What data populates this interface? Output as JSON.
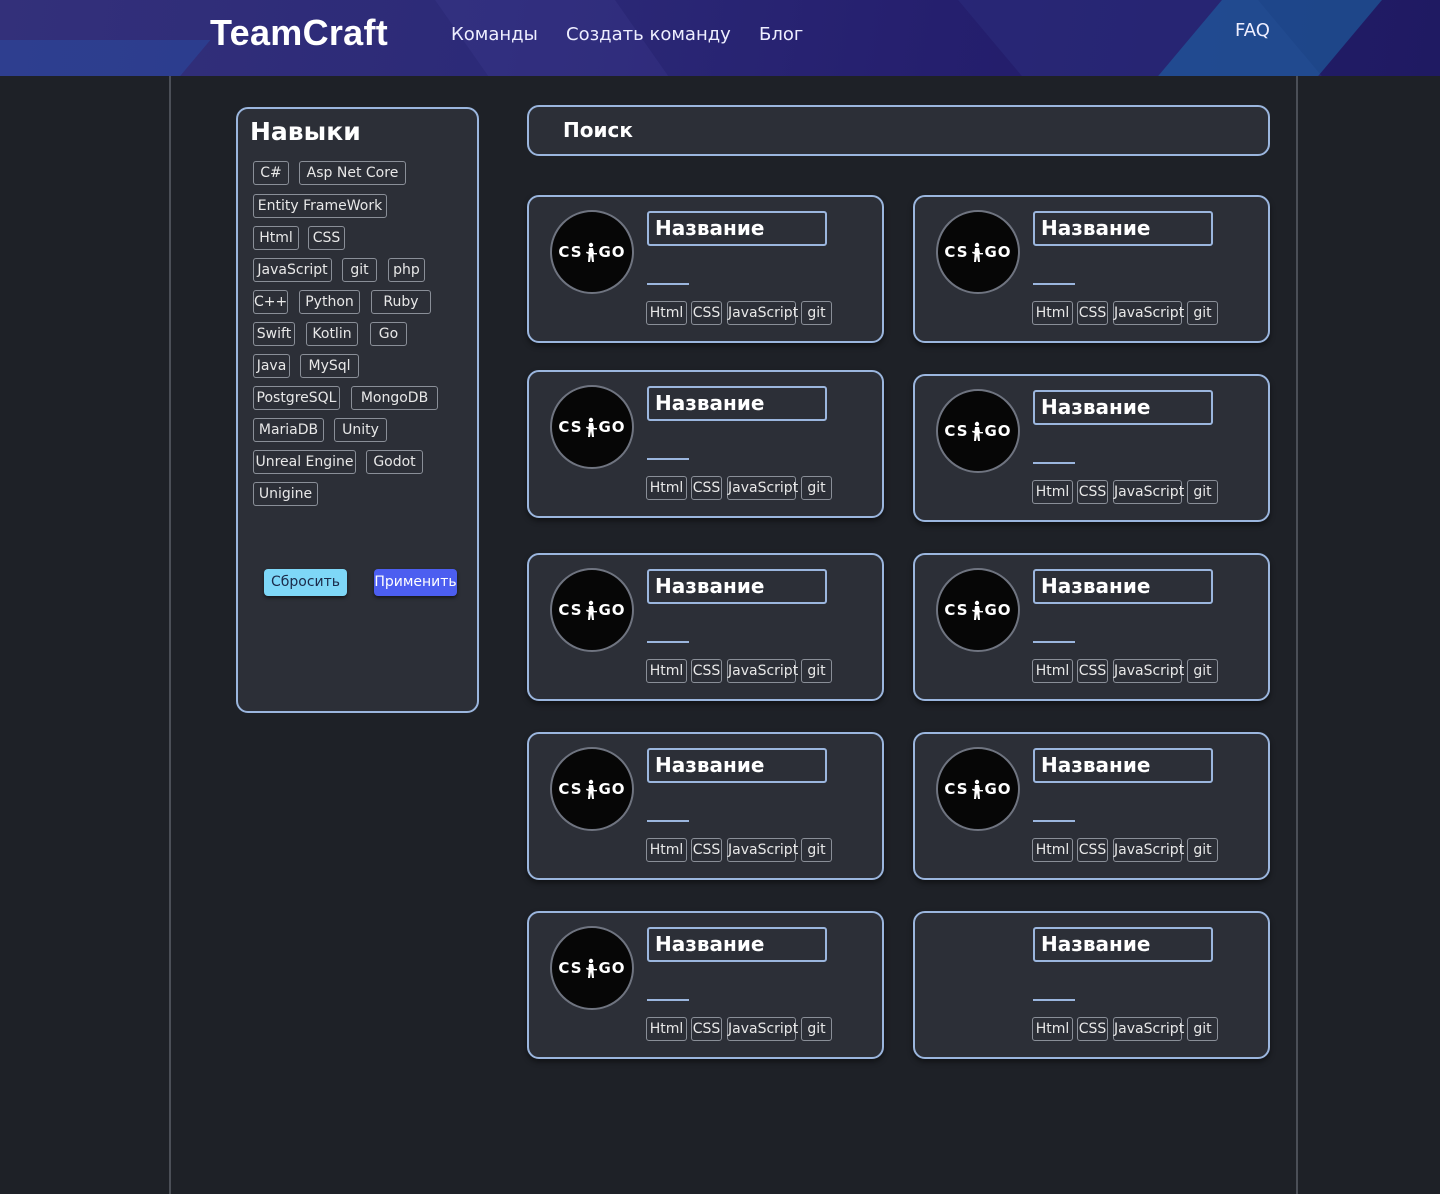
{
  "header": {
    "logo": "TeamCraft",
    "nav": [
      "Команды",
      "Создать команду",
      "Блог"
    ],
    "faq": "FAQ"
  },
  "skills": {
    "title": "Навыки",
    "items": [
      "C#",
      "Asp Net Core",
      "Entity FrameWork",
      "Html",
      "CSS",
      "JavaScript",
      "git",
      "php",
      "C++",
      "Python",
      "Ruby",
      "Swift",
      "Kotlin",
      "Go",
      "Java",
      "MySql",
      "PostgreSQL",
      "MongoDB",
      "MariaDB",
      "Unity",
      "Unreal Engine",
      "Godot",
      "Unigine"
    ],
    "reset_label": "Сбросить",
    "apply_label": "Применить"
  },
  "search": {
    "label": "Поиск"
  },
  "teams": [
    {
      "name": "Название",
      "avatar_text": "CS GO",
      "tags": [
        "Html",
        "CSS",
        "JavaScript",
        "git"
      ]
    },
    {
      "name": "Название",
      "avatar_text": "CS GO",
      "tags": [
        "Html",
        "CSS",
        "JavaScript",
        "git"
      ]
    },
    {
      "name": "Название",
      "avatar_text": "CS GO",
      "tags": [
        "Html",
        "CSS",
        "JavaScript",
        "git"
      ]
    },
    {
      "name": "Название",
      "avatar_text": "CS GO",
      "tags": [
        "Html",
        "CSS",
        "JavaScript",
        "git"
      ]
    },
    {
      "name": "Название",
      "avatar_text": "CS GO",
      "tags": [
        "Html",
        "CSS",
        "JavaScript",
        "git"
      ]
    },
    {
      "name": "Название",
      "avatar_text": "CS GO",
      "tags": [
        "Html",
        "CSS",
        "JavaScript",
        "git"
      ]
    },
    {
      "name": "Название",
      "avatar_text": "CS GO",
      "tags": [
        "Html",
        "CSS",
        "JavaScript",
        "git"
      ]
    },
    {
      "name": "Название",
      "avatar_text": "CS GO",
      "tags": [
        "Html",
        "CSS",
        "JavaScript",
        "git"
      ]
    },
    {
      "name": "Название",
      "avatar_text": "CS GO",
      "tags": [
        "Html",
        "CSS",
        "JavaScript",
        "git"
      ]
    },
    {
      "name": "Название",
      "avatar_text": "",
      "tags": [
        "Html",
        "CSS",
        "JavaScript",
        "git"
      ]
    }
  ]
}
